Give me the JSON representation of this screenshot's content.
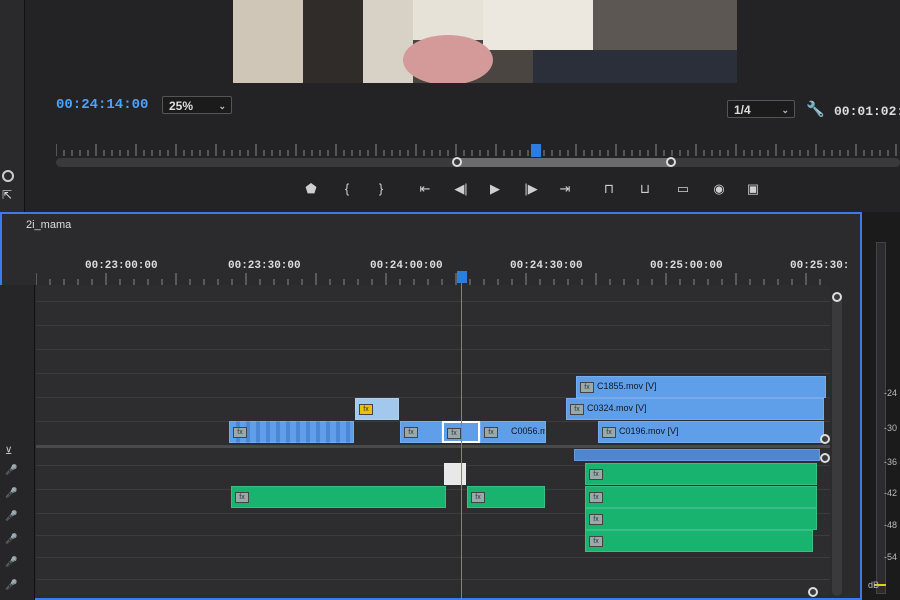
{
  "monitor": {
    "current_timecode": "00:24:14:00",
    "zoom_level": "25%",
    "resolution": "1/4",
    "duration_timecode": "00:01:02:0",
    "in_point_fraction": 0.47,
    "out_point_fraction": 0.72,
    "playhead_fraction": 0.57
  },
  "transport": {
    "buttons": [
      {
        "name": "add-marker-button",
        "glyph": "⬟"
      },
      {
        "name": "mark-in-button",
        "glyph": "{"
      },
      {
        "name": "mark-out-button",
        "glyph": "}"
      },
      {
        "name": "go-to-in-button",
        "glyph": "⇤"
      },
      {
        "name": "step-back-button",
        "glyph": "◀|"
      },
      {
        "name": "play-button",
        "glyph": "▶"
      },
      {
        "name": "step-forward-button",
        "glyph": "|▶"
      },
      {
        "name": "go-to-out-button",
        "glyph": "⇥"
      },
      {
        "name": "lift-button",
        "glyph": "⊓"
      },
      {
        "name": "extract-button",
        "glyph": "⊔"
      },
      {
        "name": "button-editor-button",
        "glyph": "▭"
      },
      {
        "name": "export-frame-button",
        "glyph": "◉"
      },
      {
        "name": "compare-view-button",
        "glyph": "▣"
      }
    ]
  },
  "timeline": {
    "sequence_name": "2i_mama",
    "ruler": [
      "00:23:00:00",
      "00:23:30:00",
      "00:24:00:00",
      "00:24:30:00",
      "00:25:00:00",
      "00:25:30:"
    ],
    "fx_label": "fx",
    "clips": {
      "c1855": "C1855.mov [V]",
      "c0324": "C0324.mov [V]",
      "c0196": "C0196.mov [V]",
      "c0056": "C0056.m"
    }
  },
  "meter": {
    "db_labels": [
      "-24",
      "-30",
      "-36",
      "-42",
      "-48",
      "-54",
      "dB"
    ]
  },
  "colors": {
    "accent": "#3a7cf0",
    "video_clip": "#5f9ee8",
    "audio_clip": "#18b36e",
    "timecode": "#4aa3ff"
  }
}
